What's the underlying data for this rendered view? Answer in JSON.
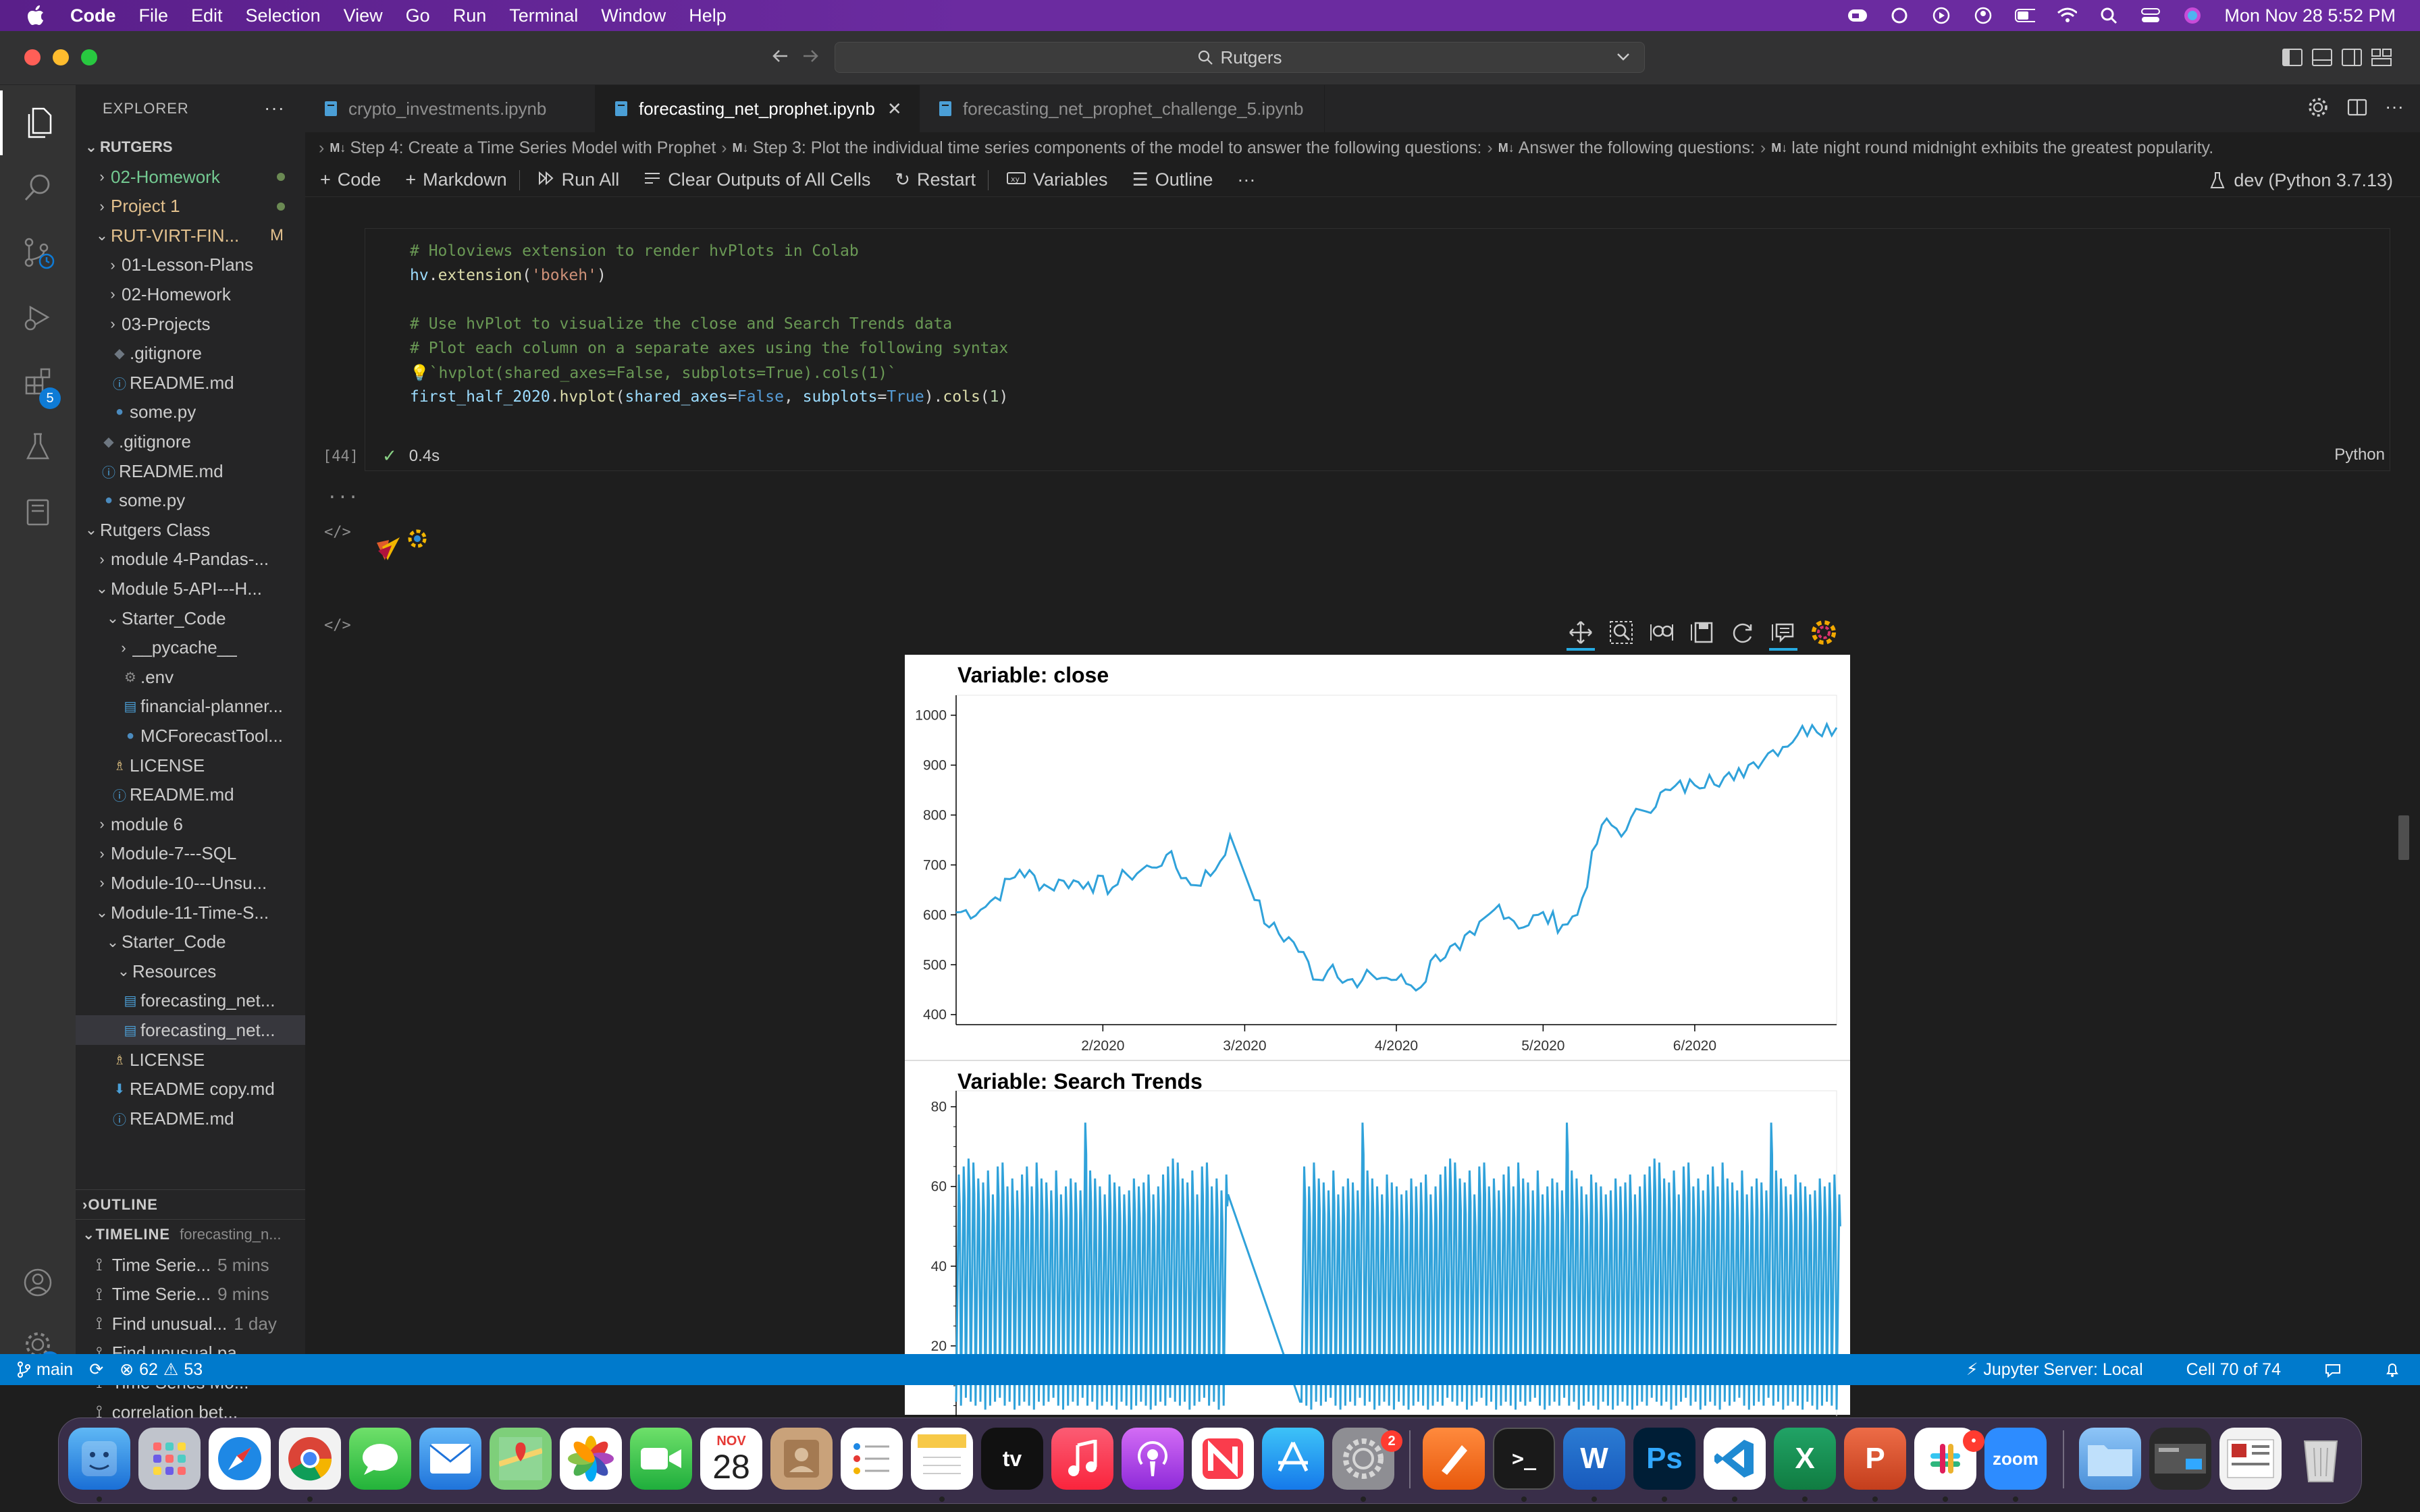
{
  "menubar": {
    "items": [
      "Code",
      "File",
      "Edit",
      "Selection",
      "View",
      "Go",
      "Run",
      "Terminal",
      "Window",
      "Help"
    ],
    "datetime": "Mon Nov 28  5:52 PM"
  },
  "titlebar": {
    "command_center": "Rutgers"
  },
  "activity_bar": {
    "extensions_badge": "5",
    "settings_badge": "1"
  },
  "explorer": {
    "title": "EXPLORER",
    "root": "RUTGERS",
    "tree": [
      {
        "label": "02-Homework",
        "indent": 1,
        "type": "folder",
        "expanded": false,
        "color": "#73c991",
        "dot": true
      },
      {
        "label": "Project 1",
        "indent": 1,
        "type": "folder",
        "expanded": false,
        "color": "#e2c08d",
        "dot": true
      },
      {
        "label": "RUT-VIRT-FIN...",
        "indent": 1,
        "type": "folder",
        "expanded": true,
        "color": "#e2c08d",
        "mod": "M"
      },
      {
        "label": "01-Lesson-Plans",
        "indent": 2,
        "type": "folder",
        "expanded": false
      },
      {
        "label": "02-Homework",
        "indent": 2,
        "type": "folder",
        "expanded": false
      },
      {
        "label": "03-Projects",
        "indent": 2,
        "type": "folder",
        "expanded": false
      },
      {
        "label": ".gitignore",
        "indent": 2,
        "type": "git"
      },
      {
        "label": "README.md",
        "indent": 2,
        "type": "info"
      },
      {
        "label": "some.py",
        "indent": 2,
        "type": "py"
      },
      {
        "label": ".gitignore",
        "indent": 1,
        "type": "git"
      },
      {
        "label": "README.md",
        "indent": 1,
        "type": "info"
      },
      {
        "label": "some.py",
        "indent": 1,
        "type": "py"
      },
      {
        "label": "Rutgers Class",
        "indent": 0,
        "type": "folder",
        "expanded": true
      },
      {
        "label": "module 4-Pandas-...",
        "indent": 1,
        "type": "folder",
        "expanded": false
      },
      {
        "label": "Module 5-API---H...",
        "indent": 1,
        "type": "folder",
        "expanded": true
      },
      {
        "label": "Starter_Code",
        "indent": 2,
        "type": "folder",
        "expanded": true
      },
      {
        "label": "__pycache__",
        "indent": 3,
        "type": "folder",
        "expanded": false
      },
      {
        "label": ".env",
        "indent": 3,
        "type": "gear"
      },
      {
        "label": "financial-planner...",
        "indent": 3,
        "type": "nb"
      },
      {
        "label": "MCForecastTool...",
        "indent": 3,
        "type": "py"
      },
      {
        "label": "LICENSE",
        "indent": 2,
        "type": "license"
      },
      {
        "label": "README.md",
        "indent": 2,
        "type": "info"
      },
      {
        "label": "module 6",
        "indent": 1,
        "type": "folder",
        "expanded": false
      },
      {
        "label": "Module-7---SQL",
        "indent": 1,
        "type": "folder",
        "expanded": false
      },
      {
        "label": "Module-10---Unsu...",
        "indent": 1,
        "type": "folder",
        "expanded": false
      },
      {
        "label": "Module-11-Time-S...",
        "indent": 1,
        "type": "folder",
        "expanded": true
      },
      {
        "label": "Starter_Code",
        "indent": 2,
        "type": "folder",
        "expanded": true
      },
      {
        "label": "Resources",
        "indent": 3,
        "type": "folder",
        "expanded": true
      },
      {
        "label": "forecasting_net...",
        "indent": 3,
        "type": "nb"
      },
      {
        "label": "forecasting_net...",
        "indent": 3,
        "type": "nb",
        "selected": true
      },
      {
        "label": "LICENSE",
        "indent": 2,
        "type": "license"
      },
      {
        "label": "README copy.md",
        "indent": 2,
        "type": "mddown"
      },
      {
        "label": "README.md",
        "indent": 2,
        "type": "info"
      }
    ],
    "outline_label": "OUTLINE",
    "timeline_label": "TIMELINE",
    "timeline_file": "forecasting_n...",
    "timeline": [
      {
        "label": "Time Serie...",
        "time": "5 mins"
      },
      {
        "label": "Time Serie...",
        "time": "9 mins"
      },
      {
        "label": "Find unusual...",
        "time": "1 day"
      },
      {
        "label": "Find unusual pa...",
        "time": ""
      },
      {
        "label": "Time Series Mo...",
        "time": ""
      },
      {
        "label": "correlation bet...",
        "time": ""
      }
    ]
  },
  "tabs": [
    {
      "label": "crypto_investments.ipynb",
      "active": false
    },
    {
      "label": "forecasting_net_prophet.ipynb",
      "active": true
    },
    {
      "label": "forecasting_net_prophet_challenge_5.ipynb",
      "active": false
    }
  ],
  "breadcrumb": [
    "Step 4: Create a Time Series Model with Prophet",
    "Step 3: Plot the individual time series components of the model to answer the following questions:",
    "Answer the following questions:",
    "late night round midnight exhibits the greatest popularity."
  ],
  "breadcrumb_md_tag": "M↓",
  "notebook_toolbar": {
    "code": "Code",
    "markdown": "Markdown",
    "run_all": "Run All",
    "clear_outputs": "Clear Outputs of All Cells",
    "restart": "Restart",
    "variables": "Variables",
    "outline": "Outline",
    "kernel": "dev (Python 3.7.13)"
  },
  "cell": {
    "lines": [
      [
        {
          "t": "# Holoviews extension to render hvPlots in Colab",
          "c": "c-comment"
        }
      ],
      [
        {
          "t": "hv",
          "c": "c-ident"
        },
        {
          "t": ".",
          "c": "c-plain"
        },
        {
          "t": "extension",
          "c": "c-fn"
        },
        {
          "t": "(",
          "c": "c-plain"
        },
        {
          "t": "'bokeh'",
          "c": "c-str"
        },
        {
          "t": ")",
          "c": "c-plain"
        }
      ],
      [],
      [
        {
          "t": "# Use hvPlot to visualize the close and Search Trends data",
          "c": "c-comment"
        }
      ],
      [
        {
          "t": "# Plot each column on a separate axes using the following syntax",
          "c": "c-comment"
        }
      ],
      [
        {
          "t": "💡",
          "c": "c-plain"
        },
        {
          "t": "`hvplot(shared_axes=False, subplots=True).cols(1)`",
          "c": "c-comment"
        }
      ],
      [
        {
          "t": "first_half_2020",
          "c": "c-ident"
        },
        {
          "t": ".",
          "c": "c-plain"
        },
        {
          "t": "hvplot",
          "c": "c-fn"
        },
        {
          "t": "(",
          "c": "c-plain"
        },
        {
          "t": "shared_axes",
          "c": "c-ident"
        },
        {
          "t": "=",
          "c": "c-plain"
        },
        {
          "t": "False",
          "c": "c-kw"
        },
        {
          "t": ", ",
          "c": "c-plain"
        },
        {
          "t": "subplots",
          "c": "c-ident"
        },
        {
          "t": "=",
          "c": "c-plain"
        },
        {
          "t": "True",
          "c": "c-kw"
        },
        {
          "t": ").",
          "c": "c-plain"
        },
        {
          "t": "cols",
          "c": "c-fn"
        },
        {
          "t": "(",
          "c": "c-plain"
        },
        {
          "t": "1",
          "c": "c-num"
        },
        {
          "t": ")",
          "c": "c-plain"
        }
      ]
    ],
    "exec_count": "[44]",
    "duration": "0.4s",
    "language": "Python"
  },
  "chart_data": [
    {
      "type": "line",
      "title": "Variable: close",
      "xlabel": "",
      "ylabel": "",
      "x_ticks": [
        "2/2020",
        "3/2020",
        "4/2020",
        "5/2020",
        "6/2020"
      ],
      "y_ticks": [
        400,
        500,
        600,
        700,
        800,
        900,
        1000
      ],
      "ylim": [
        380,
        1040
      ],
      "x": [
        "2020-01-02",
        "2020-01-07",
        "2020-01-10",
        "2020-01-15",
        "2020-01-21",
        "2020-01-24",
        "2020-01-29",
        "2020-02-03",
        "2020-02-06",
        "2020-02-11",
        "2020-02-14",
        "2020-02-19",
        "2020-02-24",
        "2020-02-27",
        "2020-03-03",
        "2020-03-06",
        "2020-03-11",
        "2020-03-16",
        "2020-03-19",
        "2020-03-24",
        "2020-03-27",
        "2020-04-01",
        "2020-04-06",
        "2020-04-09",
        "2020-04-14",
        "2020-04-17",
        "2020-04-22",
        "2020-04-27",
        "2020-04-30",
        "2020-05-05",
        "2020-05-08",
        "2020-05-13",
        "2020-05-18",
        "2020-05-21",
        "2020-05-27",
        "2020-06-01",
        "2020-06-04",
        "2020-06-09",
        "2020-06-12",
        "2020-06-17",
        "2020-06-22",
        "2020-06-25",
        "2020-06-30"
      ],
      "values": [
        605,
        610,
        635,
        690,
        655,
        668,
        665,
        655,
        680,
        695,
        720,
        660,
        690,
        760,
        630,
        575,
        545,
        470,
        500,
        455,
        480,
        470,
        455,
        520,
        530,
        560,
        620,
        575,
        600,
        580,
        600,
        780,
        770,
        810,
        850,
        860,
        880,
        870,
        900,
        930,
        960,
        980,
        975
      ]
    },
    {
      "type": "line",
      "title": "Variable: Search Trends",
      "xlabel": "",
      "ylabel": "",
      "y_ticks": [
        20,
        40,
        60,
        80
      ],
      "ylim": [
        0,
        84
      ],
      "note_pattern": "hourly sawtooth",
      "x_range": [
        "2020-01-01",
        "2020-06-30"
      ],
      "gap": [
        "2020-02-25",
        "2020-03-12"
      ],
      "peak_values": [
        63,
        65,
        67,
        66,
        62,
        61,
        64,
        58,
        65,
        66,
        60,
        62,
        59,
        63,
        65,
        60,
        66,
        62,
        61,
        59,
        64,
        58,
        60,
        62,
        61,
        59,
        76,
        64,
        62,
        60,
        58,
        63,
        61,
        60,
        58,
        59,
        62,
        60,
        61,
        63,
        58,
        60
      ],
      "low_values": [
        6,
        5,
        7,
        6,
        5,
        6,
        4,
        5,
        6,
        7,
        5,
        6,
        4,
        5,
        6,
        5,
        4,
        6,
        5,
        6,
        7,
        5,
        4,
        5,
        6,
        5,
        7,
        5,
        6,
        4,
        5,
        6,
        5,
        4,
        6,
        5,
        4,
        5,
        6,
        5,
        4,
        5
      ]
    }
  ],
  "statusbar": {
    "branch": "main",
    "errors": "62",
    "warnings": "53",
    "jupyter": "Jupyter Server: Local",
    "cell": "Cell 70 of 74"
  },
  "dock": {
    "calendar_month": "NOV",
    "calendar_day": "28",
    "settings_badge": "2",
    "slack_badge": "•",
    "tv_label": "tv",
    "zoom_label": "zoom",
    "ps_label": "Ps"
  }
}
